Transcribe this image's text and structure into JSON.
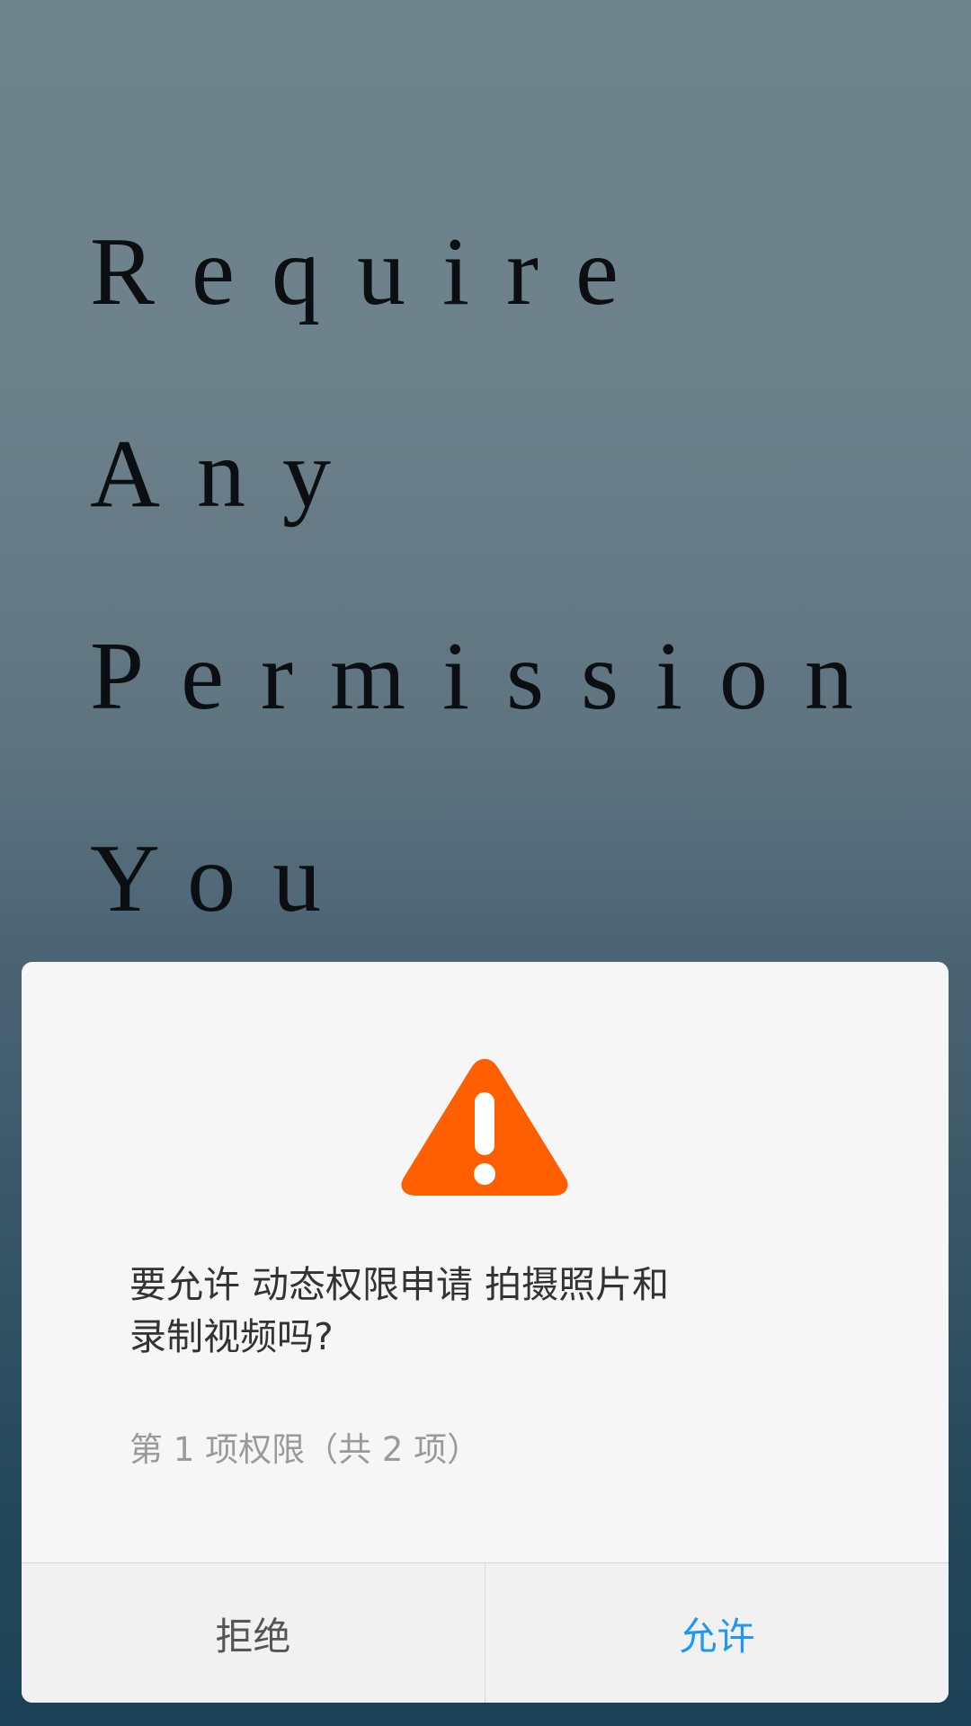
{
  "background": {
    "words": [
      "Require",
      "Any",
      "Permission",
      "You"
    ]
  },
  "dialog": {
    "icon": "warning-triangle-icon",
    "accent_color": "#ff5f00",
    "message_line1": "要允许 动态权限申请 拍摄照片和",
    "message_line2": "录制视频吗?",
    "counter": "第 1 项权限（共 2 项）",
    "deny_label": "拒绝",
    "allow_label": "允许",
    "allow_color": "#2196f3"
  }
}
